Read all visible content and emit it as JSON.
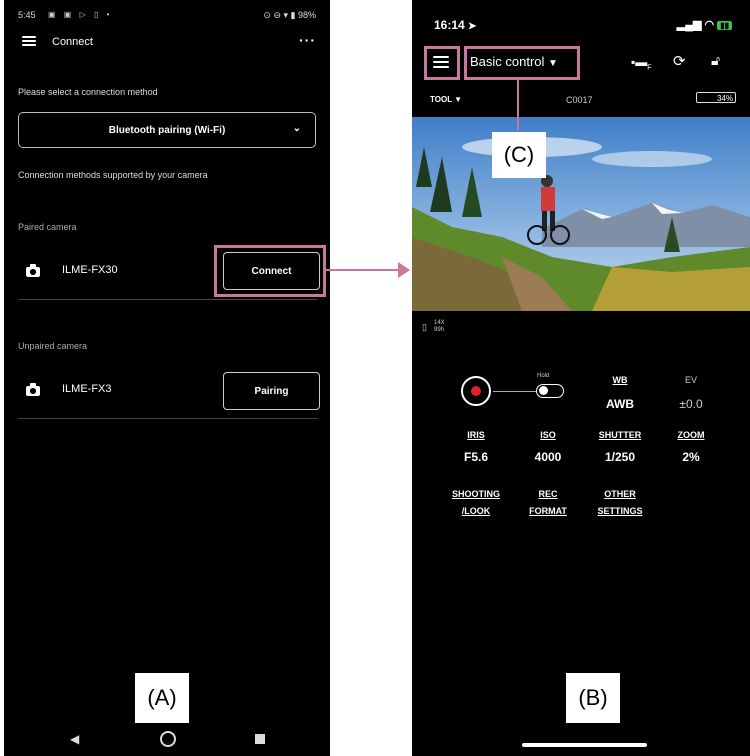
{
  "phone_a": {
    "status": {
      "time": "5:45",
      "battery": "98%"
    },
    "header": {
      "title": "Connect"
    },
    "prompt": "Please select a connection method",
    "method_select": {
      "value": "Bluetooth pairing (Wi-Fi)"
    },
    "supported_link": "Connection methods supported by your camera",
    "paired": {
      "heading": "Paired camera",
      "camera_name": "ILME-FX30",
      "button": "Connect"
    },
    "unpaired": {
      "heading": "Unpaired camera",
      "camera_name": "ILME-FX3",
      "button": "Pairing"
    }
  },
  "phone_b": {
    "status": {
      "time": "16:14"
    },
    "header": {
      "mode": "Basic control"
    },
    "subheader": {
      "tool": "TOOL",
      "clip": "C0017",
      "battery": "34%"
    },
    "media": {
      "line1": "14X",
      "line2": "99h"
    },
    "controls": {
      "hold": "Hold",
      "wb": {
        "label": "WB",
        "value": "AWB"
      },
      "ev": {
        "label": "EV",
        "value": "±0.0"
      },
      "iris": {
        "label": "IRIS",
        "value": "F5.6"
      },
      "iso": {
        "label": "ISO",
        "value": "4000"
      },
      "shutter": {
        "label": "SHUTTER",
        "value": "1/250"
      },
      "zoom": {
        "label": "ZOOM",
        "value": "2%"
      },
      "shooting": {
        "l1": "SHOOTING",
        "l2": "/LOOK"
      },
      "rec_format": {
        "l1": "REC",
        "l2": "FORMAT"
      },
      "other": {
        "l1": "OTHER",
        "l2": "SETTINGS"
      }
    }
  },
  "callouts": {
    "a": "(A)",
    "b": "(B)",
    "c": "(C)"
  },
  "colors": {
    "highlight": "#c8789f",
    "record": "#e0202a"
  }
}
